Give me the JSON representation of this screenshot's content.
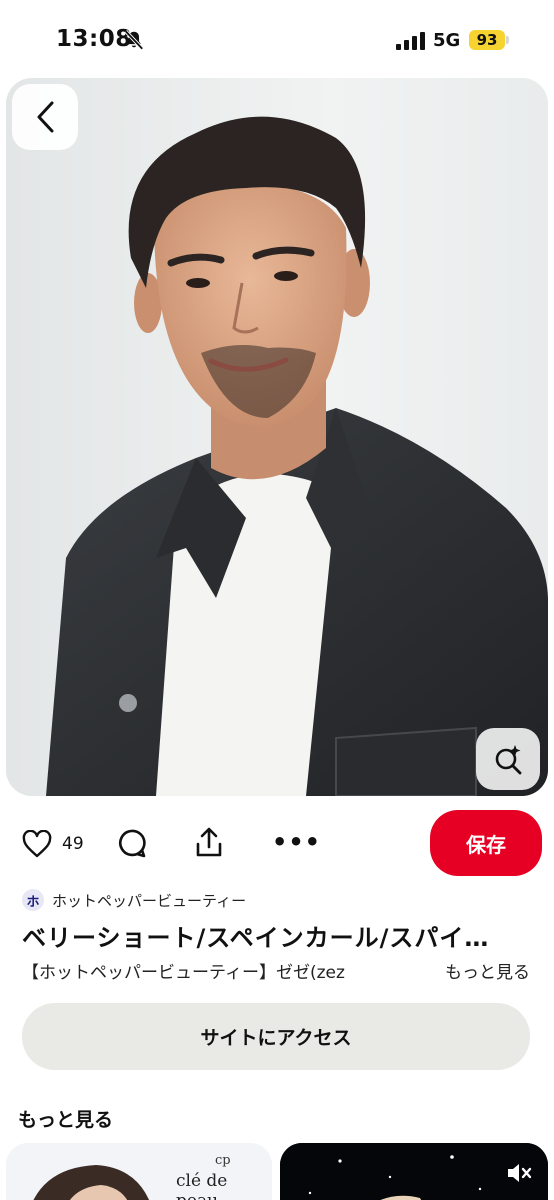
{
  "status_bar": {
    "time": "13:08",
    "network": "5G",
    "battery": "93"
  },
  "pin": {
    "like_count": "49",
    "save_label": "保存",
    "source_initial": "ホ",
    "source_name": "ホットペッパービューティー",
    "title": "ベリーショート/スペインカール/スパイ…",
    "description": "【ホットペッパービューティー】ゼゼ(zez",
    "read_more": "もっと見る",
    "visit_label": "サイトにアクセス"
  },
  "more_section": {
    "heading": "もっと見る",
    "brand_text": "clé de peau"
  },
  "colors": {
    "save_red": "#e60023",
    "battery_yellow": "#f6d330",
    "visit_gray": "#e9e9e6"
  },
  "icons": [
    "bell-off-icon",
    "signal-icon",
    "back-arrow-icon",
    "visual-search-icon",
    "heart-icon",
    "comment-icon",
    "share-icon",
    "more-dots-icon",
    "mute-icon"
  ]
}
